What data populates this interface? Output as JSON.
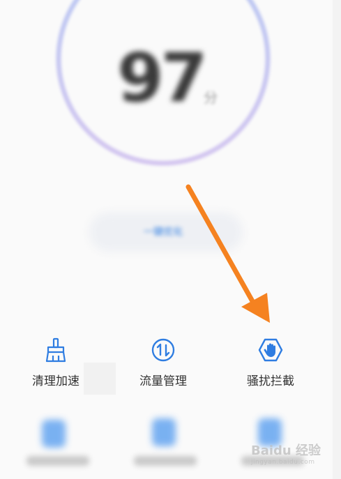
{
  "score": {
    "value": "97",
    "unit": "分"
  },
  "optimize_button": {
    "label": "一键优化"
  },
  "tools": [
    {
      "label": "清理加速",
      "icon": "broom-icon"
    },
    {
      "label": "流量管理",
      "icon": "data-transfer-icon"
    },
    {
      "label": "骚扰拦截",
      "icon": "block-hand-icon"
    }
  ],
  "blurred_tools": [
    {
      "icon": "battery-icon"
    },
    {
      "icon": "app-lock-icon"
    },
    {
      "icon": "virus-scan-icon"
    }
  ],
  "annotation": {
    "arrow_color": "#f58220",
    "points_to": "骚扰拦截"
  },
  "watermark": {
    "text": "Baidu 经验",
    "sub": "jingyan.baidu.com"
  },
  "colors": {
    "accent": "#2f7de1",
    "ring_start": "#b7c8f3",
    "ring_end": "#d4c6f0"
  }
}
